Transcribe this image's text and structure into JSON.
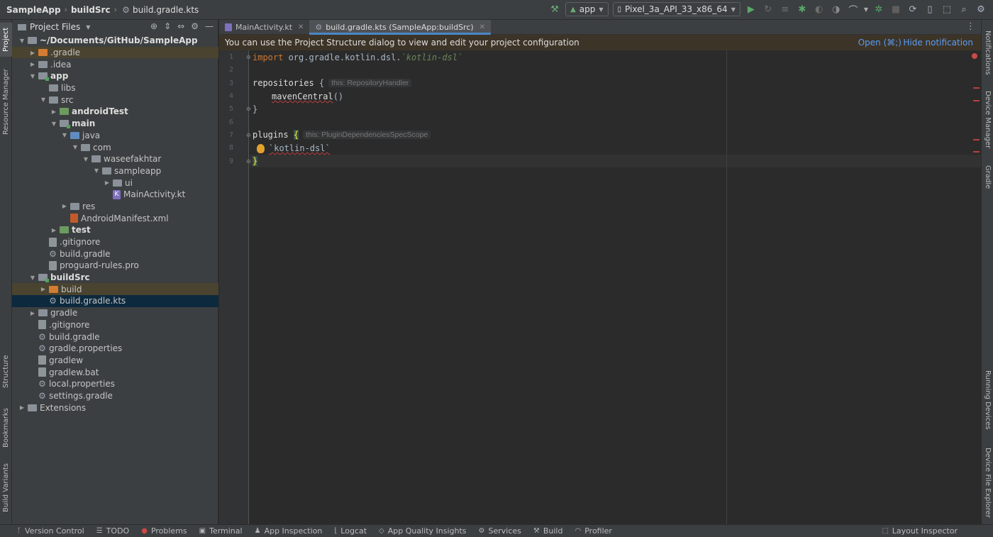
{
  "titlebar": {
    "breadcrumbs": [
      "SampleApp",
      "buildSrc",
      "build.gradle.kts"
    ],
    "run_config": "app",
    "device": "Pixel_3a_API_33_x86_64"
  },
  "left_strip": {
    "tabs": [
      "Project",
      "Resource Manager",
      "Structure",
      "Bookmarks",
      "Build Variants"
    ]
  },
  "right_strip": {
    "tabs": [
      "Notifications",
      "Device Manager",
      "Gradle",
      "Running Devices",
      "Device File Explorer"
    ]
  },
  "project_panel": {
    "title": "Project Files",
    "tree": [
      {
        "label": "~/Documents/GitHub/SampleApp",
        "depth": 0,
        "arrow": "down",
        "icon": "folder-grey",
        "bold": true
      },
      {
        "label": ".gradle",
        "depth": 1,
        "arrow": "right",
        "icon": "folder-orange",
        "highlight": "orange"
      },
      {
        "label": ".idea",
        "depth": 1,
        "arrow": "right",
        "icon": "folder-grey"
      },
      {
        "label": "app",
        "depth": 1,
        "arrow": "down",
        "icon": "folder-module",
        "bold": true
      },
      {
        "label": "libs",
        "depth": 2,
        "arrow": "",
        "icon": "folder-grey"
      },
      {
        "label": "src",
        "depth": 2,
        "arrow": "down",
        "icon": "folder-grey"
      },
      {
        "label": "androidTest",
        "depth": 3,
        "arrow": "right",
        "icon": "folder-test",
        "bold": true
      },
      {
        "label": "main",
        "depth": 3,
        "arrow": "down",
        "icon": "folder-module",
        "bold": true
      },
      {
        "label": "java",
        "depth": 4,
        "arrow": "down",
        "icon": "folder-blue"
      },
      {
        "label": "com",
        "depth": 5,
        "arrow": "down",
        "icon": "folder-grey"
      },
      {
        "label": "waseefakhtar",
        "depth": 6,
        "arrow": "down",
        "icon": "folder-grey"
      },
      {
        "label": "sampleapp",
        "depth": 7,
        "arrow": "down",
        "icon": "folder-grey"
      },
      {
        "label": "ui",
        "depth": 8,
        "arrow": "right",
        "icon": "folder-grey"
      },
      {
        "label": "MainActivity.kt",
        "depth": 8,
        "arrow": "",
        "icon": "file-kt"
      },
      {
        "label": "res",
        "depth": 4,
        "arrow": "right",
        "icon": "folder-grey"
      },
      {
        "label": "AndroidManifest.xml",
        "depth": 4,
        "arrow": "",
        "icon": "file-xml"
      },
      {
        "label": "test",
        "depth": 3,
        "arrow": "right",
        "icon": "folder-test",
        "bold": true
      },
      {
        "label": ".gitignore",
        "depth": 2,
        "arrow": "",
        "icon": "file-txt"
      },
      {
        "label": "build.gradle",
        "depth": 2,
        "arrow": "",
        "icon": "file-gradle"
      },
      {
        "label": "proguard-rules.pro",
        "depth": 2,
        "arrow": "",
        "icon": "file-txt"
      },
      {
        "label": "buildSrc",
        "depth": 1,
        "arrow": "down",
        "icon": "folder-module",
        "bold": true
      },
      {
        "label": "build",
        "depth": 2,
        "arrow": "right",
        "icon": "folder-orange",
        "highlight": "orange"
      },
      {
        "label": "build.gradle.kts",
        "depth": 2,
        "arrow": "",
        "icon": "file-gradle",
        "highlight": "selected"
      },
      {
        "label": "gradle",
        "depth": 1,
        "arrow": "right",
        "icon": "folder-grey"
      },
      {
        "label": ".gitignore",
        "depth": 1,
        "arrow": "",
        "icon": "file-txt"
      },
      {
        "label": "build.gradle",
        "depth": 1,
        "arrow": "",
        "icon": "file-gradle"
      },
      {
        "label": "gradle.properties",
        "depth": 1,
        "arrow": "",
        "icon": "file-gradle"
      },
      {
        "label": "gradlew",
        "depth": 1,
        "arrow": "",
        "icon": "file-txt"
      },
      {
        "label": "gradlew.bat",
        "depth": 1,
        "arrow": "",
        "icon": "file-txt"
      },
      {
        "label": "local.properties",
        "depth": 1,
        "arrow": "",
        "icon": "file-gradle"
      },
      {
        "label": "settings.gradle",
        "depth": 1,
        "arrow": "",
        "icon": "file-gradle"
      },
      {
        "label": "Extensions",
        "depth": 0,
        "arrow": "right",
        "icon": "folder-grey"
      }
    ]
  },
  "tabs": [
    {
      "label": "MainActivity.kt",
      "active": false
    },
    {
      "label": "build.gradle.kts (SampleApp:buildSrc)",
      "active": true
    }
  ],
  "banner": {
    "message": "You can use the Project Structure dialog to view and edit your project configuration",
    "open_link": "Open (⌘;)",
    "hide_link": "Hide notification"
  },
  "editor": {
    "line_numbers": [
      "1",
      "2",
      "3",
      "4",
      "5",
      "6",
      "7",
      "8",
      "9"
    ],
    "line1_kw": "import",
    "line1_path": " org.gradle.kotlin.dsl.",
    "line1_tick": "`kotlin-dsl`",
    "line3_fn": "repositories",
    "line3_brace": " {",
    "line3_hint": "this: RepositoryHandler",
    "line4_fn": "mavenCentral",
    "line4_paren": "()",
    "line5": "}",
    "line7_fn": "plugins",
    "line7_brace": "{",
    "line7_hint": "this: PluginDependenciesSpecScope",
    "line8_str": "`kotlin-dsl`",
    "line9": "}"
  },
  "statusbar": {
    "items": [
      "Version Control",
      "TODO",
      "Problems",
      "Terminal",
      "App Inspection",
      "Logcat",
      "App Quality Insights",
      "Services",
      "Build",
      "Profiler"
    ],
    "right_item": "Layout Inspector"
  }
}
